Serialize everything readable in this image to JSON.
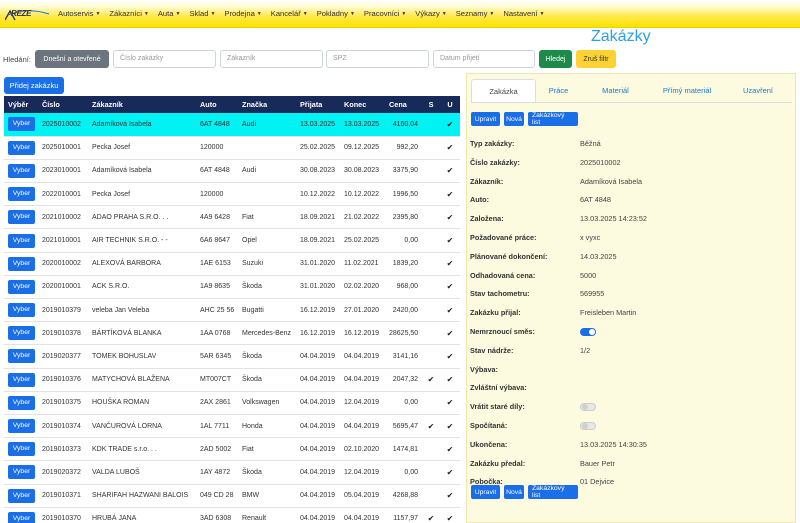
{
  "nav": {
    "logo": "REZE",
    "items": [
      "Autoservis",
      "Zákazníci",
      "Auta",
      "Sklad",
      "Prodejna",
      "Kancelář",
      "Pokladny",
      "Pracovníci",
      "Výkazy",
      "Seznamy",
      "Nastavení"
    ]
  },
  "page_title": "Zakázky",
  "filter": {
    "label": "Hledání:",
    "preset_button": "Dnešní a otevřené",
    "order_placeholder": "Číslo zakázky",
    "customer_placeholder": "Zákazník",
    "spz_placeholder": "SPZ",
    "date_placeholder": "Datum přijetí",
    "search_button": "Hledej",
    "clear_button": "Zruš filtr"
  },
  "add_button": "Přidej zakázku",
  "table": {
    "headers": [
      "Výběr",
      "Číslo",
      "Zákazník",
      "Auto",
      "Značka",
      "Přijata",
      "Konec",
      "Cena",
      "S",
      "U"
    ],
    "select_label": "Vyber",
    "rows": [
      {
        "cislo": "2025010002",
        "zakaznik": "Adamíková Isabela",
        "auto": "6AT 4848",
        "znacka": "Audi",
        "prijata": "13.03.2025",
        "konec": "13.03.2025",
        "cena": "4160,04",
        "s": "",
        "u": "✔"
      },
      {
        "cislo": "2025010001",
        "zakaznik": "Pecka Josef",
        "auto": "120000",
        "znacka": "",
        "prijata": "25.02.2025",
        "konec": "09.12.2025",
        "cena": "992,20",
        "s": "",
        "u": "✔"
      },
      {
        "cislo": "2023010001",
        "zakaznik": "Adamíková Isabela",
        "auto": "6AT 4848",
        "znacka": "Audi",
        "prijata": "30.08.2023",
        "konec": "30.08.2023",
        "cena": "3375,90",
        "s": "",
        "u": "✔"
      },
      {
        "cislo": "2022010001",
        "zakaznik": "Pecka Josef",
        "auto": "120000",
        "znacka": "",
        "prijata": "10.12.2022",
        "konec": "10.12.2022",
        "cena": "1996,50",
        "s": "",
        "u": "✔"
      },
      {
        "cislo": "2021010002",
        "zakaznik": "ADAO PRAHA S.R.O. . .",
        "auto": "4A9 6428",
        "znacka": "Fiat",
        "prijata": "18.09.2021",
        "konec": "21.02.2022",
        "cena": "2395,80",
        "s": "",
        "u": "✔"
      },
      {
        "cislo": "2021010001",
        "zakaznik": "AIR TECHNIK S.R.O. - -",
        "auto": "6A6 8647",
        "znacka": "Opel",
        "prijata": "18.09.2021",
        "konec": "25.02.2025",
        "cena": "0,00",
        "s": "",
        "u": "✔"
      },
      {
        "cislo": "2020010002",
        "zakaznik": "ALEXOVÁ BARBORA",
        "auto": "1AE 6153",
        "znacka": "Suzuki",
        "prijata": "31.01.2020",
        "konec": "11.02.2021",
        "cena": "1839,20",
        "s": "",
        "u": "✔"
      },
      {
        "cislo": "2020010001",
        "zakaznik": "ACK S.R.O.",
        "auto": "1A9 8635",
        "znacka": "Škoda",
        "prijata": "31.01.2020",
        "konec": "02.02.2020",
        "cena": "968,00",
        "s": "",
        "u": "✔"
      },
      {
        "cislo": "2019010379",
        "zakaznik": "veleba Jan Veleba",
        "auto": "AHC 25 56",
        "znacka": "Bugatti",
        "prijata": "16.12.2019",
        "konec": "27.01.2020",
        "cena": "2420,00",
        "s": "",
        "u": "✔"
      },
      {
        "cislo": "2019010378",
        "zakaznik": "BÁRTÍKOVÁ BLANKA",
        "auto": "1AA 0768",
        "znacka": "Mercedes-Benz",
        "prijata": "16.12.2019",
        "konec": "16.12.2019",
        "cena": "28625,50",
        "s": "",
        "u": "✔"
      },
      {
        "cislo": "2019020377",
        "zakaznik": "TOMEK BOHUSLAV",
        "auto": "5AR 6345",
        "znacka": "Škoda",
        "prijata": "04.04.2019",
        "konec": "04.04.2019",
        "cena": "3141,16",
        "s": "",
        "u": "✔"
      },
      {
        "cislo": "2019010376",
        "zakaznik": "MATYCHOVÁ BLAŽENA",
        "auto": "MT007CT",
        "znacka": "Škoda",
        "prijata": "04.04.2019",
        "konec": "04.04.2019",
        "cena": "2047,32",
        "s": "✔",
        "u": "✔"
      },
      {
        "cislo": "2019010375",
        "zakaznik": "HOUŠKA ROMAN",
        "auto": "2AX 2861",
        "znacka": "Volkswagen",
        "prijata": "04.04.2019",
        "konec": "12.04.2019",
        "cena": "0,00",
        "s": "",
        "u": "✔"
      },
      {
        "cislo": "2019010374",
        "zakaznik": "VANČUROVÁ LORNA",
        "auto": "1AL 7711",
        "znacka": "Honda",
        "prijata": "04.04.2019",
        "konec": "04.04.2019",
        "cena": "5695,47",
        "s": "✔",
        "u": "✔"
      },
      {
        "cislo": "2019010373",
        "zakaznik": "KDK TRADE s.r.o. . .",
        "auto": "2AD 5002",
        "znacka": "Fiat",
        "prijata": "04.04.2019",
        "konec": "02.10.2020",
        "cena": "1474,81",
        "s": "",
        "u": "✔"
      },
      {
        "cislo": "2019020372",
        "zakaznik": "VALDA LUBOŠ",
        "auto": "1AY 4872",
        "znacka": "Škoda",
        "prijata": "04.04.2019",
        "konec": "12.04.2019",
        "cena": "0,00",
        "s": "",
        "u": "✔"
      },
      {
        "cislo": "2019010371",
        "zakaznik": "SHARIFAH HAZWANI BALOIS",
        "auto": "049 CD 28",
        "znacka": "BMW",
        "prijata": "04.04.2019",
        "konec": "05.04.2019",
        "cena": "4268,88",
        "s": "",
        "u": "✔"
      },
      {
        "cislo": "2019010370",
        "zakaznik": "HRUBÁ JANA",
        "auto": "3AD 6308",
        "znacka": "Renault",
        "prijata": "04.04.2019",
        "konec": "04.04.2019",
        "cena": "1157,97",
        "s": "✔",
        "u": "✔"
      }
    ]
  },
  "detail": {
    "tabs": [
      "Zakázka",
      "Práce",
      "Materiál",
      "Přímý materiál",
      "Uzavření"
    ],
    "actions": [
      "Upravit",
      "Nová",
      "Zakázkový list"
    ],
    "fields": [
      {
        "label": "Typ zakázky:",
        "value": "Běžná"
      },
      {
        "label": "Číslo zakázky:",
        "value": "2025010002"
      },
      {
        "label": "Zákazník:",
        "value": "Adamíková Isabela"
      },
      {
        "label": "Auto:",
        "value": "6AT 4848"
      },
      {
        "label": "Založena:",
        "value": "13.03.2025 14:23:52"
      },
      {
        "label": "Požadované práce:",
        "value": "x vyxc"
      },
      {
        "label": "Plánované dokončení:",
        "value": "14.03.2025"
      },
      {
        "label": "Odhadovaná cena:",
        "value": "5000"
      },
      {
        "label": "Stav tachometru:",
        "value": "569955"
      },
      {
        "label": "Zakázku přijal:",
        "value": "Freisleben Martin"
      },
      {
        "label": "Nemrznoucí směs:",
        "value": ""
      },
      {
        "label": "Stav nádrže:",
        "value": "1/2"
      },
      {
        "label": "Výbava:",
        "value": ""
      },
      {
        "label": "Zvláštní výbava:",
        "value": ""
      },
      {
        "label": "Vrátit staré díly:",
        "value": ""
      },
      {
        "label": "Spočítaná:",
        "value": ""
      },
      {
        "label": "Ukončena:",
        "value": "13.03.2025 14:30:35"
      },
      {
        "label": "Zakázku předal:",
        "value": "Bauer Petr"
      },
      {
        "label": "Pobočka:",
        "value": "01 Dejvice"
      }
    ],
    "toggles": {
      "nemrznouci_smes": true,
      "vratit_stare_dily": false,
      "spocitana": false
    }
  }
}
